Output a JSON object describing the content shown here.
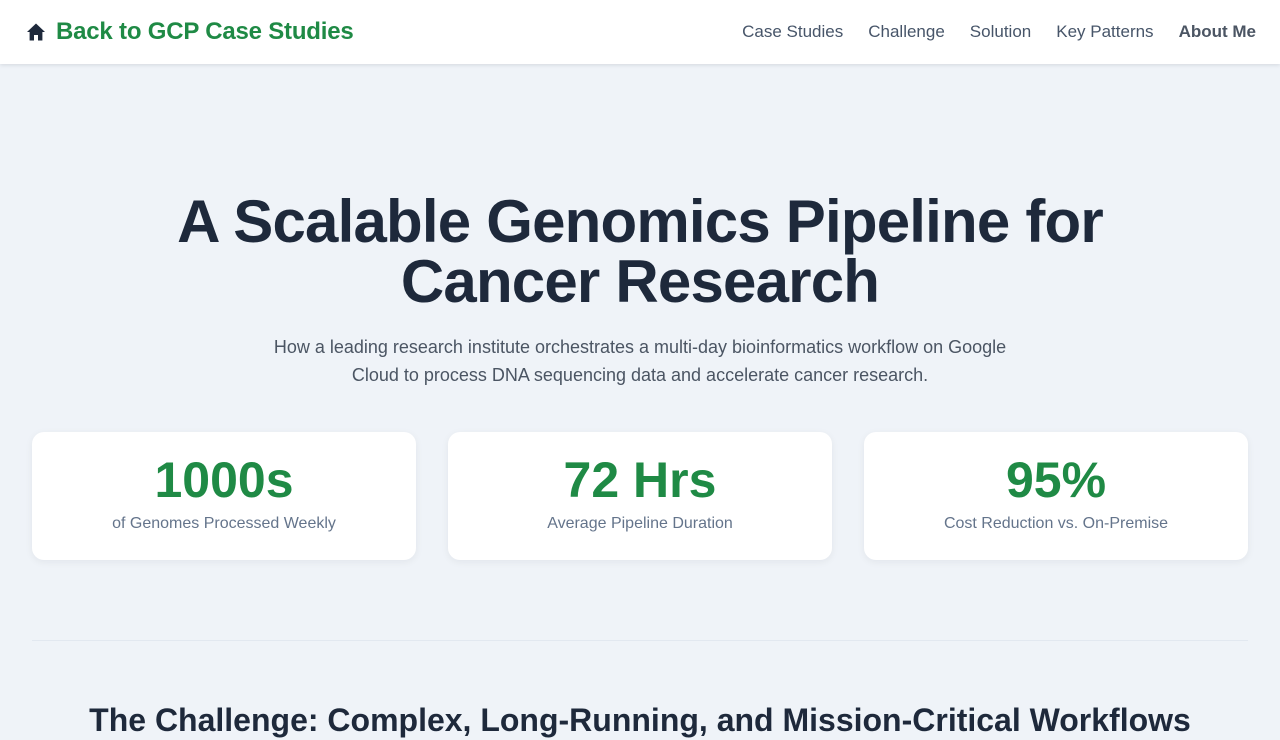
{
  "header": {
    "brand_label": "Back to GCP Case Studies",
    "brand_icon": "home-icon",
    "nav": [
      {
        "label": "Case Studies"
      },
      {
        "label": "Challenge"
      },
      {
        "label": "Solution"
      },
      {
        "label": "Key Patterns"
      },
      {
        "label": "About Me"
      }
    ]
  },
  "hero": {
    "title": "A Scalable Genomics Pipeline for Cancer Research",
    "subtitle": "How a leading research institute orchestrates a multi-day bioinformatics workflow on Google Cloud to process DNA sequencing data and accelerate cancer research."
  },
  "stats": [
    {
      "value": "1000s",
      "label": "of Genomes Processed Weekly"
    },
    {
      "value": "72 Hrs",
      "label": "Average Pipeline Duration"
    },
    {
      "value": "95%",
      "label": "Cost Reduction vs. On-Premise"
    }
  ],
  "section": {
    "heading": "The Challenge: Complex, Long-Running, and Mission-Critical Workflows"
  },
  "colors": {
    "accent": "#1f8a45",
    "background": "#eff3f8",
    "heading": "#1e293b",
    "muted": "#64748b"
  }
}
